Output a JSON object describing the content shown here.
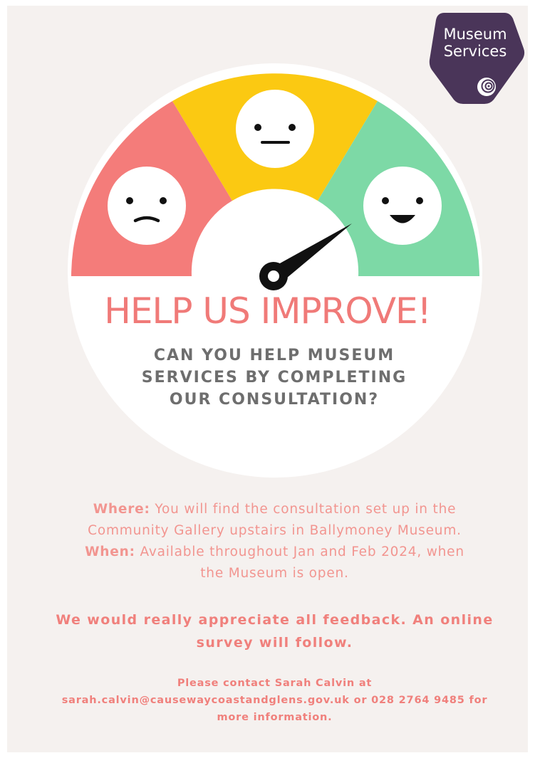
{
  "logo": {
    "line1": "Museum",
    "line2": "Services",
    "color": "#4a3559",
    "icon": "shell-icon"
  },
  "gauge": {
    "segments": [
      "sad",
      "neutral",
      "happy"
    ],
    "colors": {
      "sad": "#f47c7a",
      "neutral": "#fbc912",
      "happy": "#7dd9a6",
      "needle": "#111111"
    }
  },
  "title": "HELP US IMPROVE!",
  "subtitle": {
    "line1": "CAN YOU HELP MUSEUM",
    "line2": "SERVICES BY COMPLETING",
    "line3": "OUR CONSULTATION?"
  },
  "info": {
    "where_label": "Where:",
    "where_line1": " You will find the consultation set up in the",
    "where_line2": "Community Gallery upstairs in Ballymoney Museum.",
    "when_label": "When:",
    "when_line1": " Available throughout Jan and Feb 2024, when",
    "when_line2": "the Museum is open."
  },
  "feedback": {
    "line1": "We would really appreciate all feedback. An online",
    "line2": "survey will follow."
  },
  "contact": {
    "line1": "Please contact Sarah Calvin at",
    "line2": "sarah.calvin@causewaycoastandglens.gov.uk or 028 2764 9485 for",
    "line3": "more information."
  }
}
